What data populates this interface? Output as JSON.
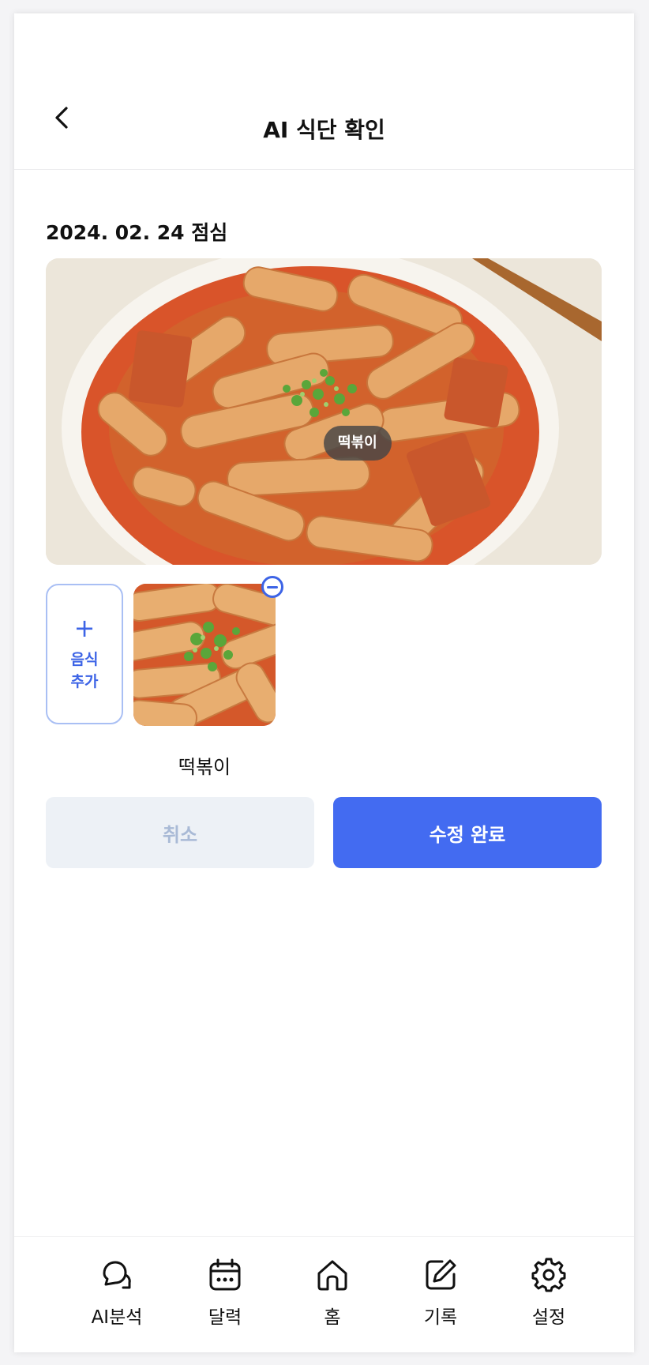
{
  "header": {
    "title": "AI 식단 확인",
    "back_icon": "chevron-left-icon"
  },
  "meal": {
    "date_label": "2024. 02. 24 점심",
    "photo_tag": "떡볶이"
  },
  "food_items": {
    "add_label": "음식 추가",
    "items": [
      {
        "name": "떡볶이"
      }
    ]
  },
  "actions": {
    "cancel_label": "취소",
    "done_label": "수정 완료"
  },
  "colors": {
    "primary": "#436bf1",
    "cancel_bg": "#edf1f6",
    "cancel_text": "#a9bad6"
  },
  "nav": {
    "items": [
      {
        "label": "AI분석",
        "icon": "chat-bubbles-icon"
      },
      {
        "label": "달력",
        "icon": "calendar-icon"
      },
      {
        "label": "홈",
        "icon": "home-icon"
      },
      {
        "label": "기록",
        "icon": "edit-icon"
      },
      {
        "label": "설정",
        "icon": "gear-icon"
      }
    ]
  }
}
